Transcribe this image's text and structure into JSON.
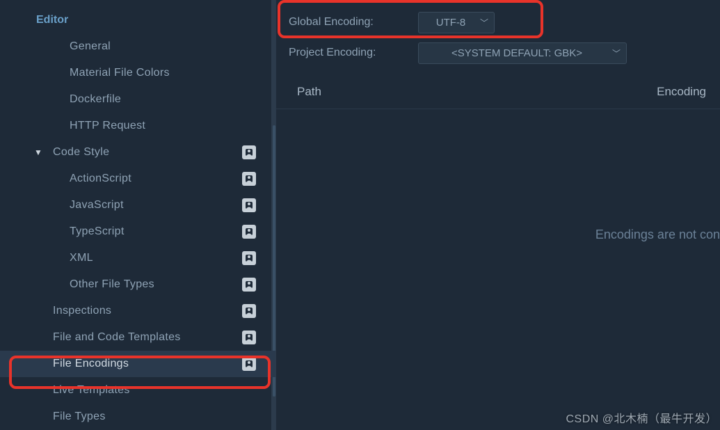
{
  "sidebar": {
    "section": "Editor",
    "items": [
      {
        "label": "General",
        "level": 1,
        "badge": false,
        "caret": null
      },
      {
        "label": "Material File Colors",
        "level": 1,
        "badge": false,
        "caret": null
      },
      {
        "label": "Dockerfile",
        "level": 1,
        "badge": false,
        "caret": null
      },
      {
        "label": "HTTP Request",
        "level": 1,
        "badge": false,
        "caret": null
      },
      {
        "label": "Code Style",
        "level": 0,
        "badge": true,
        "caret": "▼"
      },
      {
        "label": "ActionScript",
        "level": 1,
        "badge": true,
        "caret": null
      },
      {
        "label": "JavaScript",
        "level": 1,
        "badge": true,
        "caret": null
      },
      {
        "label": "TypeScript",
        "level": 1,
        "badge": true,
        "caret": null
      },
      {
        "label": "XML",
        "level": 1,
        "badge": true,
        "caret": null
      },
      {
        "label": "Other File Types",
        "level": 1,
        "badge": true,
        "caret": null
      },
      {
        "label": "Inspections",
        "level": 0,
        "badge": true,
        "caret": null
      },
      {
        "label": "File and Code Templates",
        "level": 0,
        "badge": true,
        "caret": null
      },
      {
        "label": "File Encodings",
        "level": 0,
        "badge": true,
        "caret": null,
        "selected": true
      },
      {
        "label": "Live Templates",
        "level": 0,
        "badge": false,
        "caret": null
      },
      {
        "label": "File Types",
        "level": 0,
        "badge": false,
        "caret": null
      }
    ]
  },
  "settings": {
    "global_label": "Global Encoding:",
    "global_value": "UTF-8",
    "project_label": "Project Encoding:",
    "project_value": "<SYSTEM DEFAULT: GBK>"
  },
  "table": {
    "col_path": "Path",
    "col_encoding": "Encoding"
  },
  "empty": "Encodings are not con",
  "watermark": "CSDN @北木楠（最牛开发）"
}
